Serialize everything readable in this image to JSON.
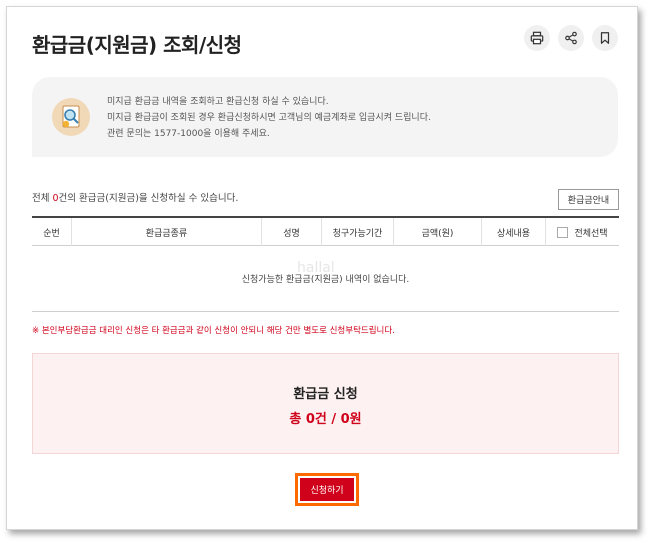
{
  "page": {
    "title": "환급금(지원금) 조회/신청",
    "icons": [
      "print-icon",
      "share-icon",
      "bookmark-icon"
    ]
  },
  "info": {
    "lines": [
      "미지급 환급금 내역을 조회하고 환급신청 하실 수 있습니다.",
      "미지급 환급금이 조회된 경우 환급신청하시면 고객님의 예금계좌로 입금시켜 드립니다.",
      "관련 문의는 1577-1000을 이용해 주세요."
    ]
  },
  "summary": {
    "prefix": "전체 ",
    "count": "0",
    "suffix": "건의 환급금(지원금)을 신청하실 수 있습니다."
  },
  "guide_button": "환급금안내",
  "table": {
    "headers": [
      "순번",
      "환급금종류",
      "성명",
      "청구가능기간",
      "금액(원)",
      "상세내용",
      "전체선택"
    ],
    "empty_message": "신청가능한 환급금(지원금) 내역이 없습니다."
  },
  "notice": "※ 본인부담환급금 대리인 신청은 타 환급금과 같이 신청이 안되니 해당 건만 별도로 신청부탁드립니다.",
  "total": {
    "title": "환급금 신청",
    "value": "총 0건 / 0원"
  },
  "apply_button": "신청하기",
  "watermark": "hallal",
  "colors": {
    "accent_red": "#d0021b",
    "highlight_orange": "#ff6a00",
    "total_bg": "#fdf1f1"
  }
}
